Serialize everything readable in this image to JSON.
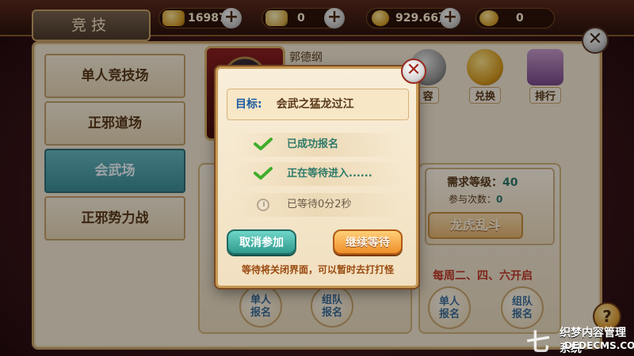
{
  "header": {
    "tab_title": "竞技",
    "resources": [
      {
        "icon": "gold-ingot-icon",
        "value": "169876",
        "has_plus": true
      },
      {
        "icon": "silver-ingot-icon",
        "value": "0",
        "has_plus": true
      },
      {
        "icon": "coins-icon",
        "value": "929.66万",
        "has_plus": true
      },
      {
        "icon": "gold-pot-icon",
        "value": "0",
        "has_plus": false
      }
    ],
    "close_label": "✕"
  },
  "sidebar": {
    "items": [
      {
        "label": "单人竞技场",
        "active": false
      },
      {
        "label": "正邪道场",
        "active": false
      },
      {
        "label": "会武场",
        "active": true
      },
      {
        "label": "正邪势力战",
        "active": false
      }
    ]
  },
  "main": {
    "hero_name": "郭德纲",
    "action_buttons": [
      {
        "label": "容",
        "icon": "sword-icon"
      },
      {
        "label": "兑换",
        "icon": "exchange-coin-icon"
      },
      {
        "label": "排行",
        "icon": "ranking-scroll-icon"
      }
    ],
    "right_card": {
      "level_label": "需求等级：",
      "level_value": "40",
      "count_label": "参与次数：",
      "count_value": "0",
      "banner": "龙虎乱斗",
      "schedule": "每周二、四、六开启",
      "single_signup": "单人\n报名",
      "team_signup": "组队\n报名"
    },
    "left_card": {
      "single_signup": "单人\n报名",
      "team_signup": "组队\n报名"
    },
    "help_label": "?"
  },
  "modal": {
    "close_label": "✕",
    "goal_label": "目标:",
    "goal_value": "会武之猛龙过江",
    "statuses": [
      {
        "text": "已成功报名",
        "icon": "check-icon"
      },
      {
        "text": "正在等待进入......",
        "icon": "check-icon"
      },
      {
        "text": "已等待0分2秒",
        "icon": "clock-icon"
      }
    ],
    "cancel_label": "取消参加",
    "continue_label": "继续等待",
    "note": "等待将关闭界面，可以暂时去打打怪"
  },
  "watermark": {
    "brand": "七",
    "line1": "织梦内容管理系统",
    "line2": "DEDECMS.COM"
  },
  "colors": {
    "accent_teal": "#3e8e99",
    "accent_orange": "#ef8f2a",
    "panel_bg": "#f3e8d4",
    "border_gold": "#c9a46a"
  }
}
